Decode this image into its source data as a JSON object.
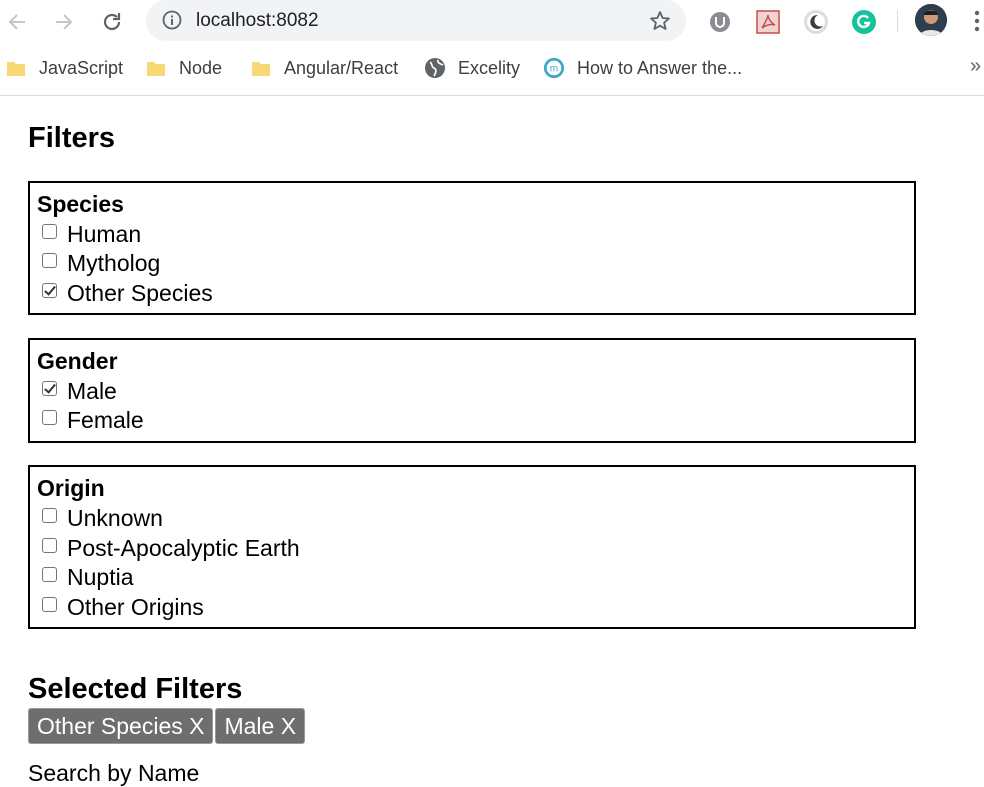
{
  "browser": {
    "url": "localhost:8082",
    "bookmarks": [
      {
        "label": "JavaScript",
        "icon": "folder-icon"
      },
      {
        "label": "Node",
        "icon": "folder-icon"
      },
      {
        "label": "Angular/React",
        "icon": "folder-icon"
      },
      {
        "label": "Excelity",
        "icon": "globe-icon"
      },
      {
        "label": "How to Answer the...",
        "icon": "m-site-icon"
      }
    ],
    "more_bookmarks": "»"
  },
  "page": {
    "title": "Filters",
    "groups": [
      {
        "title": "Species",
        "options": [
          {
            "label": "Human",
            "checked": false
          },
          {
            "label": "Mytholog",
            "checked": false
          },
          {
            "label": "Other Species",
            "checked": true
          }
        ]
      },
      {
        "title": "Gender",
        "options": [
          {
            "label": "Male",
            "checked": true
          },
          {
            "label": "Female",
            "checked": false
          }
        ]
      },
      {
        "title": "Origin",
        "options": [
          {
            "label": "Unknown",
            "checked": false
          },
          {
            "label": "Post-Apocalyptic Earth",
            "checked": false
          },
          {
            "label": "Nuptia",
            "checked": false
          },
          {
            "label": "Other Origins",
            "checked": false
          }
        ]
      }
    ],
    "selected_title": "Selected Filters",
    "selected_chips": [
      "Other Species X",
      "Male X"
    ],
    "search_label": "Search by Name"
  },
  "colors": {
    "chip_bg": "#6e6e6e",
    "grammarly": "#15c39a",
    "pdf": "#d9534f"
  }
}
